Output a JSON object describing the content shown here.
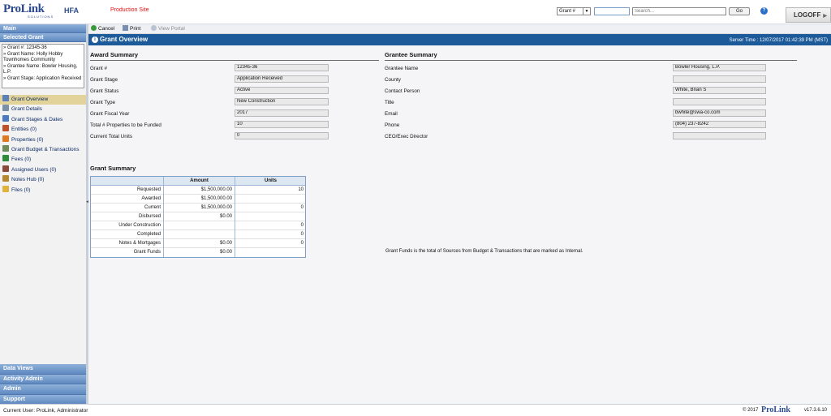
{
  "header": {
    "logo_text": "ProLink",
    "logo_sub": "SOLUTIONS",
    "app_suffix": "HFA",
    "site_label": "Production Site",
    "search_type": "Grant #",
    "search_placeholder": "Search...",
    "go_label": "Go",
    "help_label": "?",
    "logoff_label": "LOGOFF"
  },
  "sidebar": {
    "main_label": "Main",
    "selected_grant_label": "Selected Grant",
    "grant_info": [
      "» Grant #: 12345-36",
      "» Grant Name: Holly Hobby Townhomes Community",
      "» Grantee Name: Bowler Housing, L.P.",
      "» Grant Stage: Application Received"
    ],
    "items": [
      {
        "label": "Grant Overview",
        "icon": "grant-overview-icon",
        "color": "#5b7fb8"
      },
      {
        "label": "Grant Details",
        "icon": "grant-details-icon",
        "color": "#7a8fa8"
      },
      {
        "label": "Grant Stages & Dates",
        "icon": "calendar-icon",
        "color": "#4c7ac0"
      },
      {
        "label": "Entities (0)",
        "icon": "entities-icon",
        "color": "#c0502a"
      },
      {
        "label": "Properties (0)",
        "icon": "properties-icon",
        "color": "#e07a1e"
      },
      {
        "label": "Grant Budget & Transactions",
        "icon": "budget-icon",
        "color": "#6d8c5a"
      },
      {
        "label": "Fees (0)",
        "icon": "fees-icon",
        "color": "#2e8b3a"
      },
      {
        "label": "Assigned Users (0)",
        "icon": "users-icon",
        "color": "#8a4b3a"
      },
      {
        "label": "Notes Hub (0)",
        "icon": "notes-icon",
        "color": "#b58a2e"
      },
      {
        "label": "Files (0)",
        "icon": "folder-icon",
        "color": "#e0b43a"
      }
    ],
    "bottom": [
      "Data Views",
      "Activity Admin",
      "Admin",
      "Support"
    ]
  },
  "toolbar": {
    "cancel_label": "Cancel",
    "print_label": "Print",
    "view_portal_label": "View Portal"
  },
  "title_bar": {
    "title": "Grant Overview",
    "server_time": "Server Time : 12/07/2017 01:42:39 PM (MST)"
  },
  "award_summary": {
    "heading": "Award Summary",
    "fields": [
      {
        "label": "Grant #",
        "value": "12345-36"
      },
      {
        "label": "Grant Stage",
        "value": "Application Received"
      },
      {
        "label": "Grant Status",
        "value": "Active"
      },
      {
        "label": "Grant Type",
        "value": "New Construction"
      },
      {
        "label": "Grant Fiscal Year",
        "value": "2017"
      },
      {
        "label": "Total # Properties to be Funded",
        "value": "10"
      },
      {
        "label": "Current Total Units",
        "value": "0"
      }
    ]
  },
  "grantee_summary": {
    "heading": "Grantee Summary",
    "fields": [
      {
        "label": "Grantee Name",
        "value": "Bowler Housing, L.P."
      },
      {
        "label": "County",
        "value": ""
      },
      {
        "label": "Contact Person",
        "value": "White, Brian S"
      },
      {
        "label": "Title",
        "value": ""
      },
      {
        "label": "Email",
        "value": "bwhite@swa-co.com"
      },
      {
        "label": "Phone",
        "value": "(804) 237-8242"
      },
      {
        "label": "CEO/Exec Director",
        "value": ""
      }
    ]
  },
  "grant_summary": {
    "heading": "Grant Summary",
    "columns": [
      "",
      "Amount",
      "Units"
    ],
    "rows": [
      [
        "Requested",
        "$1,500,000.00",
        "10"
      ],
      [
        "Awarded",
        "$1,500,000.00",
        ""
      ],
      [
        "Current",
        "$1,500,000.00",
        "0"
      ],
      [
        "Disbursed",
        "$0.00",
        ""
      ],
      [
        "Under Construction",
        "",
        "0"
      ],
      [
        "Completed",
        "",
        "0"
      ],
      [
        "Notes & Mortgages",
        "$0.00",
        "0"
      ],
      [
        "Grant Funds",
        "$0.00",
        ""
      ]
    ],
    "note": "Grant Funds is the total of Sources from Budget & Transactions that are marked as Internal."
  },
  "footer": {
    "current_user": "Current User: ProLink, Administrator",
    "copyright": "© 2017",
    "logo_text": "ProLink",
    "version": "v17.3.6.10"
  }
}
